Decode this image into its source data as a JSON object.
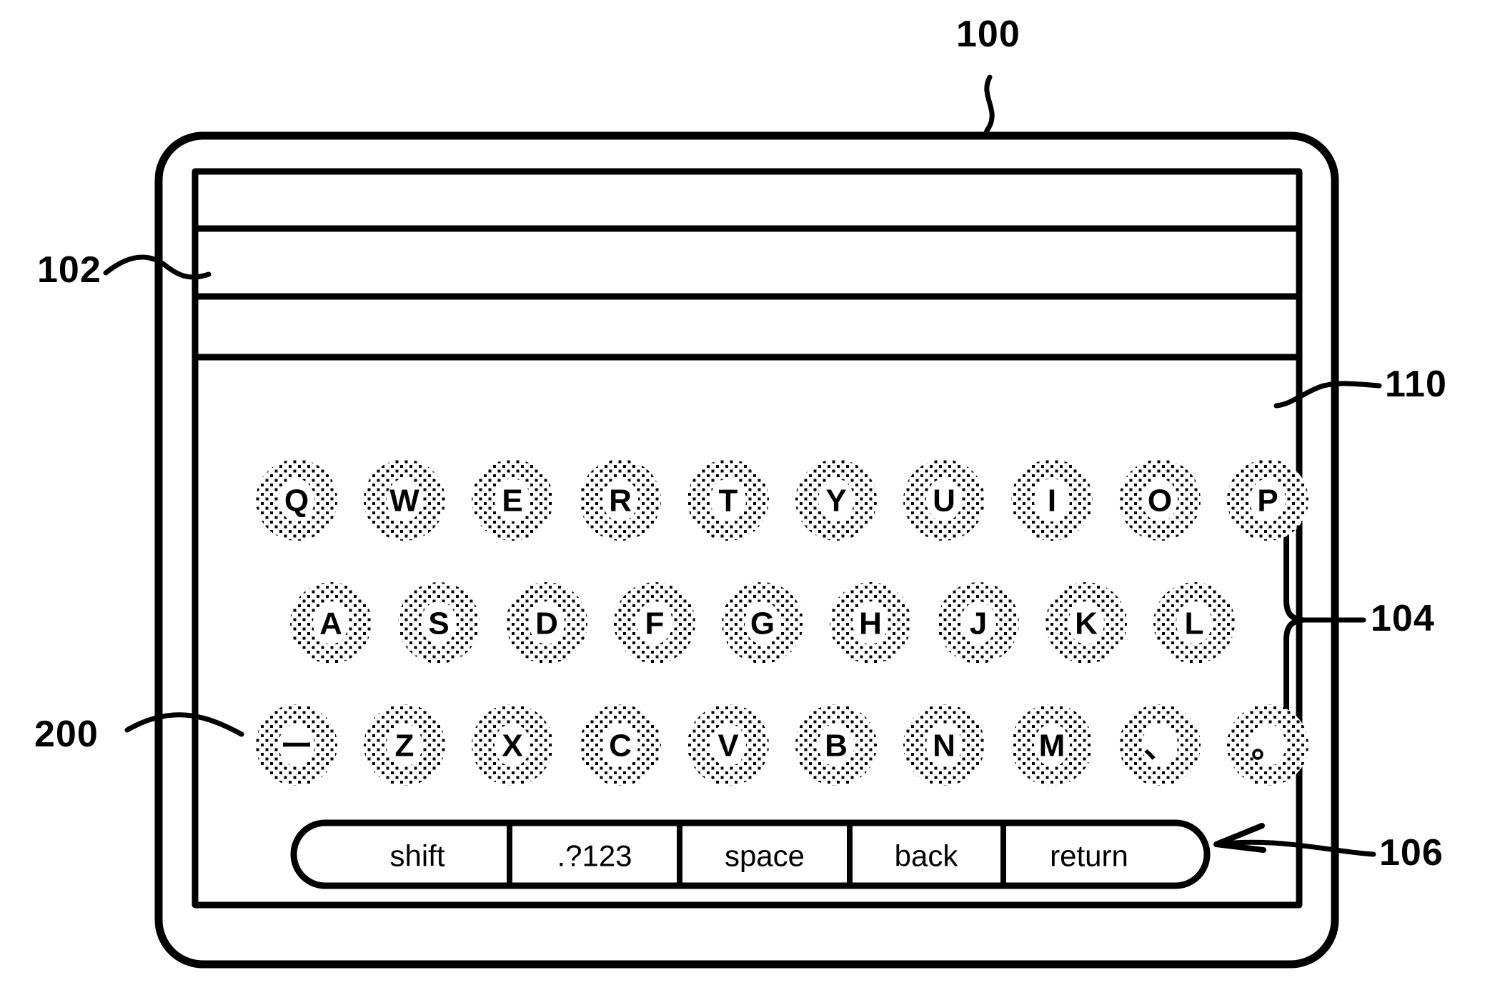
{
  "figure": {
    "kind": "patent-drawing",
    "subject": "Touch-screen device with on-screen QWERTY software keyboard",
    "line_color": "#000000",
    "background_color": "#ffffff"
  },
  "reference_numerals": [
    {
      "id": "100",
      "text": "100",
      "points_to": "device-body",
      "leader": "wavy-vertical"
    },
    {
      "id": "102",
      "text": "102",
      "points_to": "display-screen",
      "leader": "wavy-horizontal"
    },
    {
      "id": "110",
      "text": "110",
      "points_to": "keyboard-area",
      "leader": "wavy-horizontal"
    },
    {
      "id": "104",
      "text": "104",
      "points_to": "character-key-group",
      "leader": "brace"
    },
    {
      "id": "106",
      "text": "106",
      "points_to": "function-key-bar",
      "leader": "arrow"
    },
    {
      "id": "200",
      "text": "200",
      "points_to": "long-vowel-key",
      "leader": "curve"
    }
  ],
  "display": {
    "name": "display-screen",
    "rows": [
      {
        "id": "text-field-row-1",
        "label": ""
      },
      {
        "id": "text-field-row-2",
        "label": ""
      },
      {
        "id": "text-field-row-3",
        "label": ""
      }
    ]
  },
  "keyboard": {
    "name": "software-keyboard",
    "area_label": "110",
    "group_label": "104",
    "rows": [
      {
        "id": "row-1",
        "keys": [
          {
            "key": "Q",
            "label": "Q",
            "type": "letter"
          },
          {
            "key": "W",
            "label": "W",
            "type": "letter"
          },
          {
            "key": "E",
            "label": "E",
            "type": "letter"
          },
          {
            "key": "R",
            "label": "R",
            "type": "letter"
          },
          {
            "key": "T",
            "label": "T",
            "type": "letter"
          },
          {
            "key": "Y",
            "label": "Y",
            "type": "letter"
          },
          {
            "key": "U",
            "label": "U",
            "type": "letter"
          },
          {
            "key": "I",
            "label": "I",
            "type": "letter"
          },
          {
            "key": "O",
            "label": "O",
            "type": "letter"
          },
          {
            "key": "P",
            "label": "P",
            "type": "letter"
          }
        ]
      },
      {
        "id": "row-2",
        "keys": [
          {
            "key": "A",
            "label": "A",
            "type": "letter"
          },
          {
            "key": "S",
            "label": "S",
            "type": "letter"
          },
          {
            "key": "D",
            "label": "D",
            "type": "letter"
          },
          {
            "key": "F",
            "label": "F",
            "type": "letter"
          },
          {
            "key": "G",
            "label": "G",
            "type": "letter"
          },
          {
            "key": "H",
            "label": "H",
            "type": "letter"
          },
          {
            "key": "J",
            "label": "J",
            "type": "letter"
          },
          {
            "key": "K",
            "label": "K",
            "type": "letter"
          },
          {
            "key": "L",
            "label": "L",
            "type": "letter"
          }
        ]
      },
      {
        "id": "row-3",
        "keys": [
          {
            "key": "long-vowel",
            "label": "ー",
            "type": "glyph",
            "numeral": "200"
          },
          {
            "key": "Z",
            "label": "Z",
            "type": "letter"
          },
          {
            "key": "X",
            "label": "X",
            "type": "letter"
          },
          {
            "key": "C",
            "label": "C",
            "type": "letter"
          },
          {
            "key": "V",
            "label": "V",
            "type": "letter"
          },
          {
            "key": "B",
            "label": "B",
            "type": "letter"
          },
          {
            "key": "N",
            "label": "N",
            "type": "letter"
          },
          {
            "key": "M",
            "label": "M",
            "type": "letter"
          },
          {
            "key": "japanese-comma",
            "label": "、",
            "type": "glyph"
          },
          {
            "key": "japanese-period",
            "label": "。",
            "type": "glyph"
          }
        ]
      }
    ]
  },
  "function_bar": {
    "name": "function-key-bar",
    "numeral": "106",
    "keys": [
      {
        "id": "shift",
        "label": "shift"
      },
      {
        "id": "symbols",
        "label": ".?123"
      },
      {
        "id": "space",
        "label": "space"
      },
      {
        "id": "back",
        "label": "back"
      },
      {
        "id": "return",
        "label": "return"
      }
    ]
  }
}
